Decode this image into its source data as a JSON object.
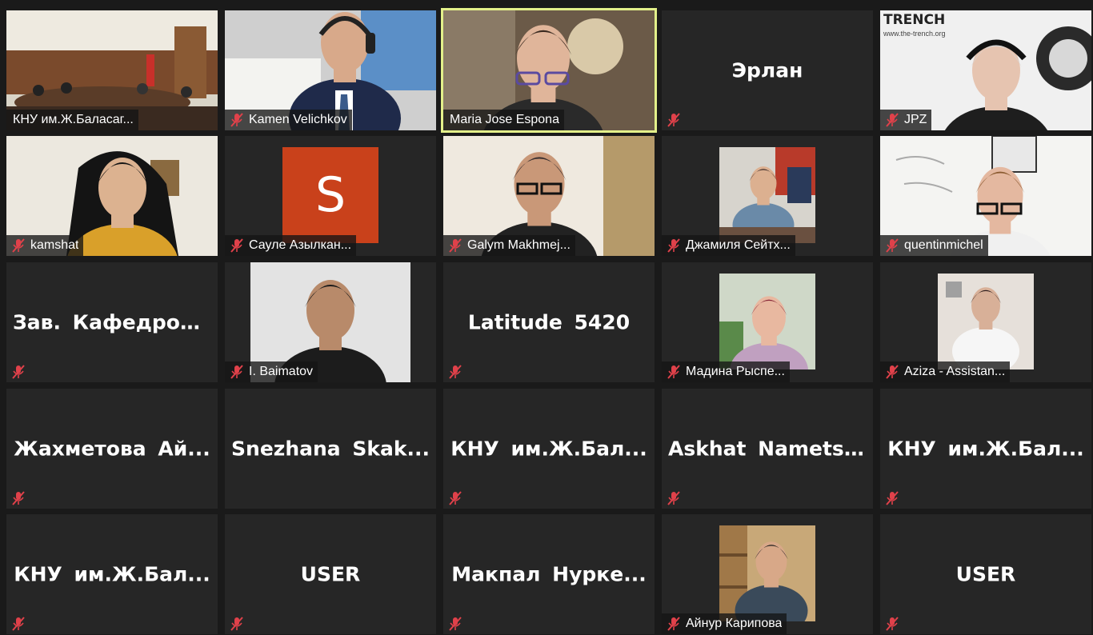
{
  "window": {
    "title": ""
  },
  "colors": {
    "tile_bg": "#262626",
    "speaker_outline": "#e3f08a",
    "mic_muted": "#e0414a",
    "avatar_s": "#c9411b"
  },
  "participants": [
    {
      "label": "КНУ им.Ж.Баласаг...",
      "center_name": "",
      "video": "conference-room",
      "muted": false,
      "speaking": false
    },
    {
      "label": "Kamen Velichkov",
      "center_name": "",
      "video": "man-headset",
      "muted": true,
      "speaking": false
    },
    {
      "label": "Maria Jose Espona",
      "center_name": "",
      "video": "woman-glasses",
      "muted": false,
      "speaking": true
    },
    {
      "label": "",
      "center_name": "Эрлан",
      "video": "none",
      "muted": true,
      "speaking": false
    },
    {
      "label": "JPZ",
      "center_name": "",
      "video": "trench-man",
      "muted": true,
      "speaking": false
    },
    {
      "label": "kamshat",
      "center_name": "",
      "video": "young-woman",
      "muted": true,
      "speaking": false
    },
    {
      "label": "Сауле Азылкан...",
      "center_name": "",
      "video": "avatar-s",
      "muted": true,
      "speaking": false,
      "avatar_letter": "S"
    },
    {
      "label": "Galym Makhmej...",
      "center_name": "",
      "video": "man-glasses",
      "muted": true,
      "speaking": false
    },
    {
      "label": "Джамиля Сейтх...",
      "center_name": "",
      "video": "woman-desk",
      "muted": true,
      "speaking": false
    },
    {
      "label": "quentinmichel",
      "center_name": "",
      "video": "man-whiteboard",
      "muted": true,
      "speaking": false
    },
    {
      "label": "",
      "center_name": "Зав.  Кафедрой...",
      "video": "none",
      "muted": true,
      "speaking": false
    },
    {
      "label": "I. Baimatov",
      "center_name": "",
      "video": "man-dark",
      "muted": true,
      "speaking": false
    },
    {
      "label": "",
      "center_name": "Latitude 5420",
      "video": "none",
      "muted": true,
      "speaking": false
    },
    {
      "label": "Мадина Рыспе...",
      "center_name": "",
      "video": "woman-smile",
      "muted": true,
      "speaking": false
    },
    {
      "label": "Aziza - Assistan...",
      "center_name": "",
      "video": "woman-white",
      "muted": true,
      "speaking": false
    },
    {
      "label": "",
      "center_name": "Жахметова  Ай...",
      "video": "none",
      "muted": true,
      "speaking": false
    },
    {
      "label": "",
      "center_name": "Snezhana  Skak...",
      "video": "none",
      "muted": false,
      "speaking": false
    },
    {
      "label": "",
      "center_name": "КНУ  им.Ж.Бал...",
      "video": "none",
      "muted": true,
      "speaking": false
    },
    {
      "label": "",
      "center_name": "Askhat Nametsha",
      "video": "none",
      "muted": true,
      "speaking": false
    },
    {
      "label": "",
      "center_name": "КНУ  им.Ж.Бал...",
      "video": "none",
      "muted": true,
      "speaking": false
    },
    {
      "label": "",
      "center_name": "КНУ  им.Ж.Бал...",
      "video": "none",
      "muted": true,
      "speaking": false
    },
    {
      "label": "",
      "center_name": "USER",
      "video": "none",
      "muted": true,
      "speaking": false
    },
    {
      "label": "",
      "center_name": "Макпал  Нурке...",
      "video": "none",
      "muted": true,
      "speaking": false
    },
    {
      "label": "Айнур Карипова",
      "center_name": "",
      "video": "woman-shelf",
      "muted": true,
      "speaking": false
    },
    {
      "label": "",
      "center_name": "USER",
      "video": "none",
      "muted": true,
      "speaking": false
    }
  ],
  "trench": {
    "logo": "TRENCH",
    "url": "www.the-trench.org"
  }
}
